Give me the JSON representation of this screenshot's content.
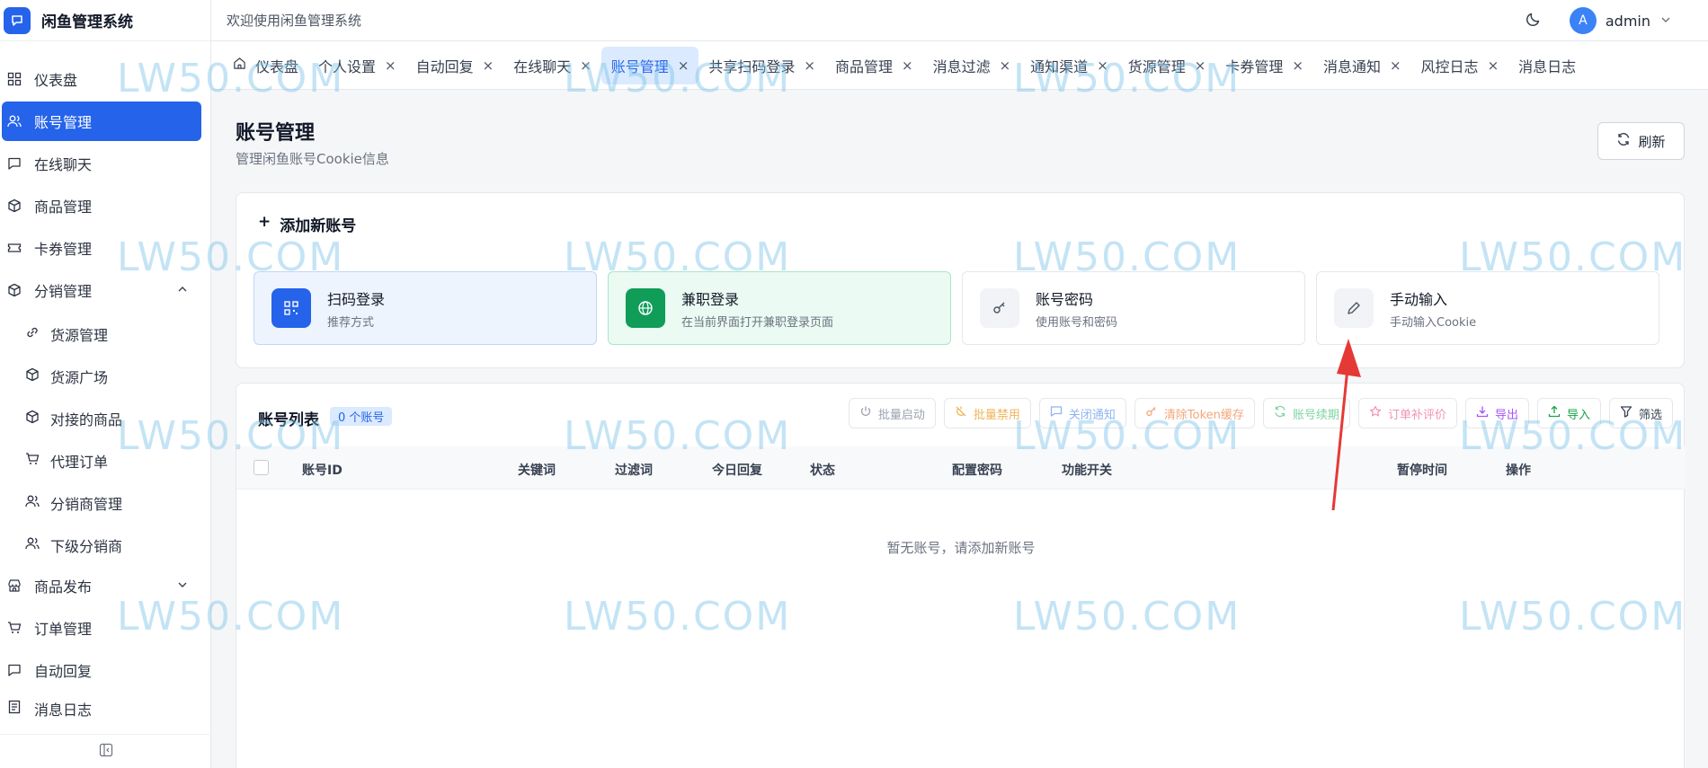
{
  "app": {
    "title": "闲鱼管理系统",
    "welcome": "欢迎使用闲鱼管理系统"
  },
  "user": {
    "avatar_letter": "A",
    "name": "admin"
  },
  "sidebar": {
    "items": [
      {
        "label": "仪表盘",
        "icon": "dashboard-icon"
      },
      {
        "label": "账号管理",
        "icon": "users-icon",
        "active": true
      },
      {
        "label": "在线聊天",
        "icon": "chat-icon"
      },
      {
        "label": "商品管理",
        "icon": "box-icon"
      },
      {
        "label": "卡券管理",
        "icon": "ticket-icon"
      },
      {
        "label": "分销管理",
        "icon": "box-icon",
        "expanded": true
      }
    ],
    "sub_items": [
      {
        "label": "货源管理",
        "icon": "link-icon"
      },
      {
        "label": "货源广场",
        "icon": "box-icon"
      },
      {
        "label": "对接的商品",
        "icon": "box-icon"
      },
      {
        "label": "代理订单",
        "icon": "cart-icon"
      },
      {
        "label": "分销商管理",
        "icon": "users-icon"
      },
      {
        "label": "下级分销商",
        "icon": "users-icon"
      }
    ],
    "items_after": [
      {
        "label": "商品发布",
        "icon": "store-icon"
      },
      {
        "label": "订单管理",
        "icon": "cart-icon"
      },
      {
        "label": "自动回复",
        "icon": "chat-icon"
      },
      {
        "label": "消息日志",
        "icon": "log-icon"
      }
    ]
  },
  "tabs": [
    {
      "label": "仪表盘",
      "closable": false
    },
    {
      "label": "个人设置",
      "closable": true
    },
    {
      "label": "自动回复",
      "closable": true
    },
    {
      "label": "在线聊天",
      "closable": true
    },
    {
      "label": "账号管理",
      "closable": true,
      "active": true
    },
    {
      "label": "共享扫码登录",
      "closable": true
    },
    {
      "label": "商品管理",
      "closable": true
    },
    {
      "label": "消息过滤",
      "closable": true
    },
    {
      "label": "通知渠道",
      "closable": true
    },
    {
      "label": "货源管理",
      "closable": true
    },
    {
      "label": "卡券管理",
      "closable": true
    },
    {
      "label": "消息通知",
      "closable": true
    },
    {
      "label": "风控日志",
      "closable": true
    },
    {
      "label": "消息日志",
      "closable": false
    }
  ],
  "close_glyph": "×",
  "page": {
    "title": "账号管理",
    "subtitle": "管理闲鱼账号Cookie信息",
    "refresh_label": "刷新"
  },
  "add_section": {
    "title": "添加新账号",
    "options": [
      {
        "title": "扫码登录",
        "desc": "推荐方式",
        "icon": "qrcode-icon",
        "bg": "#eef4fd",
        "border": "#bfd7f6",
        "icon_bg": "#2563eb"
      },
      {
        "title": "兼职登录",
        "desc": "在当前界面打开兼职登录页面",
        "icon": "globe-icon",
        "bg": "#ebfaf2",
        "border": "#a7e8c6",
        "icon_bg": "#0f9d58"
      },
      {
        "title": "账号密码",
        "desc": "使用账号和密码",
        "icon": "key-icon",
        "bg": "#ffffff",
        "border": "#e5e7eb",
        "icon_bg": "#f1f3f6"
      },
      {
        "title": "手动输入",
        "desc": "手动输入Cookie",
        "icon": "pencil-icon",
        "bg": "#ffffff",
        "border": "#e5e7eb",
        "icon_bg": "#f1f3f6"
      }
    ]
  },
  "list": {
    "title": "账号列表",
    "count_label": "0 个账号",
    "actions": [
      {
        "label": "批量启动",
        "color": "#9ca3af"
      },
      {
        "label": "批量禁用",
        "color": "#f0b45a"
      },
      {
        "label": "关闭通知",
        "color": "#8fb4f2"
      },
      {
        "label": "清除Token缓存",
        "color": "#f3a77a"
      },
      {
        "label": "账号续期",
        "color": "#7fd3a3"
      },
      {
        "label": "订单补评价",
        "color": "#f293b4"
      },
      {
        "label": "导出",
        "color": "#a855f7"
      },
      {
        "label": "导入",
        "color": "#16a34a"
      },
      {
        "label": "筛选",
        "color": "#374151"
      }
    ],
    "columns": [
      "账号ID",
      "关键词",
      "过滤词",
      "今日回复",
      "状态",
      "配置密码",
      "功能开关",
      "暂停时间",
      "操作"
    ],
    "empty_text": "暂无账号，请添加新账号"
  },
  "watermark": "LW50.COM"
}
